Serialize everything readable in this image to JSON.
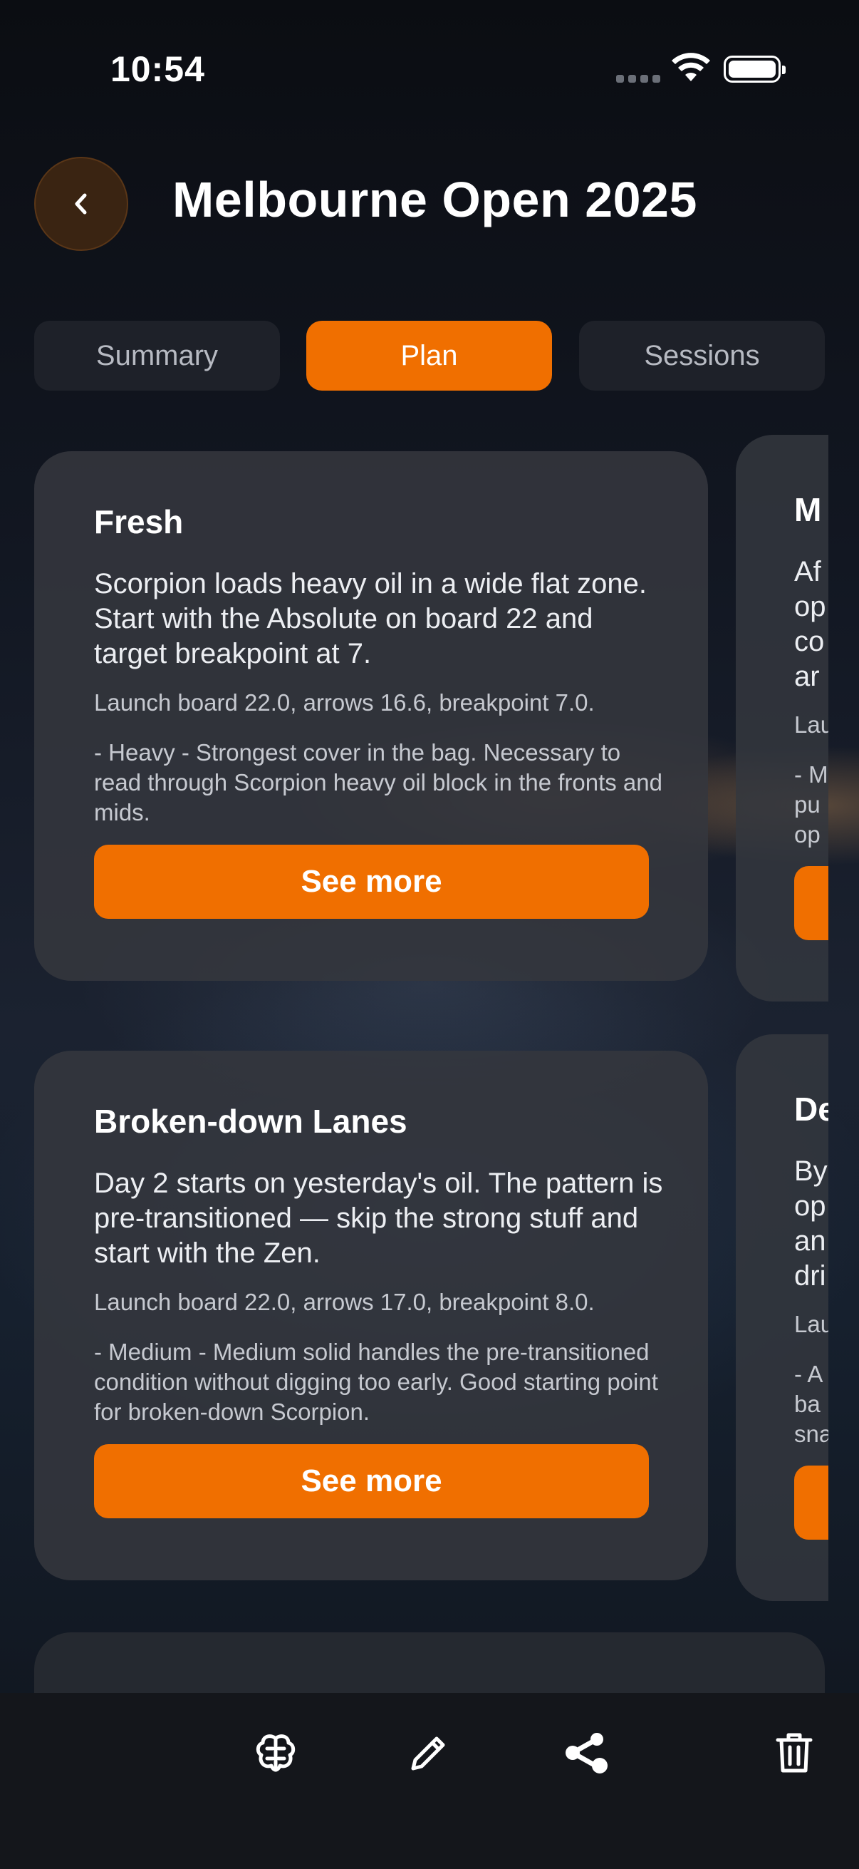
{
  "status_bar": {
    "time": "10:54"
  },
  "header": {
    "title": "Melbourne Open 2025"
  },
  "tabs": [
    {
      "label": "Summary",
      "active": false
    },
    {
      "label": "Plan",
      "active": true
    },
    {
      "label": "Sessions",
      "active": false
    }
  ],
  "cards": [
    {
      "title": "Fresh",
      "description": "Scorpion loads heavy oil in a wide flat zone.  Start with the Absolute on board 22 and target breakpoint at 7.",
      "stats": "Launch board 22.0, arrows 16.6, breakpoint 7.0.",
      "ball_note": "- Heavy - Strongest cover in the bag. Necessary to read through Scorpion heavy oil block in the fronts and mids.",
      "button": "See more"
    },
    {
      "title": "Broken-down Lanes",
      "description": "Day 2 starts on yesterday's oil.  The pattern is pre-transitioned — skip the strong stuff and start with the Zen.",
      "stats": "Launch board 22.0, arrows 17.0, breakpoint 8.0.",
      "ball_note": "- Medium - Medium solid handles the pre-transitioned condition without digging too early. Good starting point for broken-down Scorpion.",
      "button": "See more"
    }
  ],
  "peek_cards": [
    {
      "title": "M",
      "desc_lines": [
        "Af",
        "op",
        "co",
        "ar"
      ],
      "stats": "Lau",
      "ball_lines": [
        "- M",
        "pu",
        "op"
      ]
    },
    {
      "title": "De",
      "desc_lines": [
        "By",
        "op",
        "an",
        "dri"
      ],
      "stats": "Lau",
      "ball_lines": [
        "- A",
        "ba",
        "sna"
      ]
    }
  ],
  "toolbar": {
    "items": [
      "brain-icon",
      "pencil-icon",
      "share-icon",
      "trash-icon"
    ]
  },
  "colors": {
    "accent": "#f06f00",
    "card": "#34373e",
    "tab_inactive": "#1e2129"
  }
}
